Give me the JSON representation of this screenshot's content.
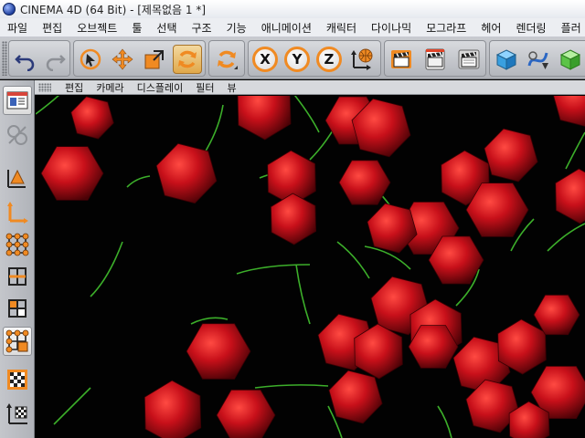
{
  "window": {
    "title": "CINEMA 4D (64 Bit) - [제목없음 1 *]"
  },
  "menu": [
    "파일",
    "편집",
    "오브젝트",
    "툴",
    "선택",
    "구조",
    "기능",
    "애니메이션",
    "캐릭터",
    "다이나믹",
    "모그라프",
    "헤어",
    "렌더링",
    "플러"
  ],
  "toolbar": {
    "buttons": [
      {
        "icon": "undo-icon"
      },
      {
        "icon": "redo-icon"
      },
      {
        "icon": "live-selection-icon"
      },
      {
        "icon": "move-icon"
      },
      {
        "icon": "scale-icon"
      },
      {
        "icon": "rotate-icon"
      },
      {
        "icon": "recent-tools-icon"
      },
      {
        "icon": "x-axis-icon",
        "label": "X"
      },
      {
        "icon": "y-axis-icon",
        "label": "Y"
      },
      {
        "icon": "z-axis-icon",
        "label": "Z"
      },
      {
        "icon": "coordinate-system-icon"
      },
      {
        "icon": "render-active-view-icon"
      },
      {
        "icon": "render-to-picture-viewer-icon"
      },
      {
        "icon": "render-settings-icon"
      },
      {
        "icon": "cube-icon"
      },
      {
        "icon": "spline-icon"
      },
      {
        "icon": "nurbs-icon"
      }
    ]
  },
  "viewport_menu": [
    "편집",
    "카메라",
    "디스플레이",
    "필터",
    "뷰"
  ],
  "left_palette": [
    {
      "icon": "layout-icon"
    },
    {
      "icon": "make-editable-icon"
    },
    {
      "icon": "model-mode-icon"
    },
    {
      "icon": "object-axis-icon"
    },
    {
      "icon": "points-mode-icon"
    },
    {
      "icon": "edges-mode-icon"
    },
    {
      "icon": "polygons-mode-icon"
    },
    {
      "icon": "uvw-points-icon"
    },
    {
      "icon": "texture-mode-icon"
    },
    {
      "icon": "workplane-icon"
    }
  ],
  "colors": {
    "accent": "#f08a22",
    "cherry": "#c81018",
    "stem": "#3cae2a",
    "viewport_bg": "#020202"
  }
}
